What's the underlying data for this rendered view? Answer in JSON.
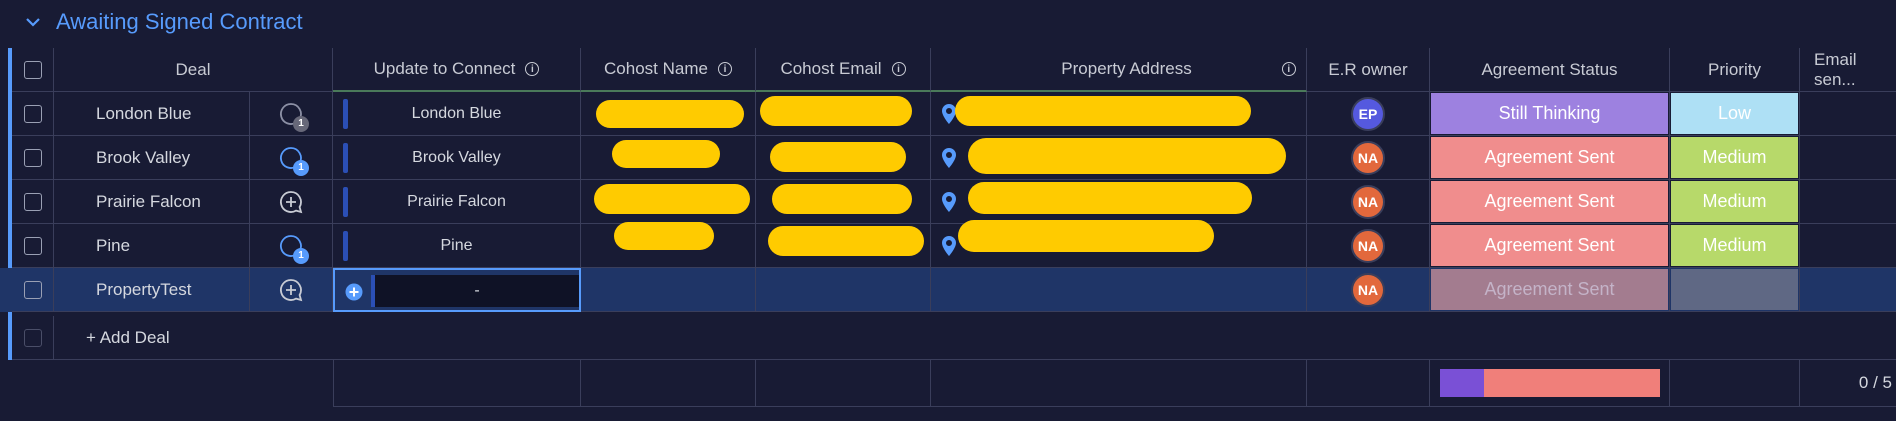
{
  "group": {
    "title": "Awaiting Signed Contract",
    "color": "#579bfc"
  },
  "columns": {
    "deal": "Deal",
    "update": "Update to Connect",
    "cohost_name": "Cohost Name",
    "cohost_email": "Cohost Email",
    "property_address": "Property Address",
    "er_owner": "E.R owner",
    "agreement_status": "Agreement Status",
    "priority": "Priority",
    "email_sent": "Email sen..."
  },
  "rows": [
    {
      "deal": "London Blue",
      "update": "London Blue",
      "conversation": "conversation-icon",
      "conv_count": "1",
      "conv_color": "#8c90a5",
      "owner": "EP",
      "owner_color": "#5559df",
      "status": "Still Thinking",
      "status_color": "#9d81e0",
      "priority": "Low",
      "priority_color": "#aee0f5",
      "priority_text_color": "#ffffff"
    },
    {
      "deal": "Brook Valley",
      "update": "Brook Valley",
      "conversation": "conversation-icon",
      "conv_count": "1",
      "conv_color": "#579bfc",
      "owner": "NA",
      "owner_color": "#e2683c",
      "status": "Agreement Sent",
      "status_color": "#f08d8d",
      "priority": "Medium",
      "priority_color": "#b7d96a",
      "priority_text_color": "#ffffff"
    },
    {
      "deal": "Prairie Falcon",
      "update": "Prairie Falcon",
      "conversation": "add-conversation-icon",
      "conv_count": "",
      "owner": "NA",
      "owner_color": "#e2683c",
      "status": "Agreement Sent",
      "status_color": "#f08d8d",
      "priority": "Medium",
      "priority_color": "#b7d96a",
      "priority_text_color": "#ffffff"
    },
    {
      "deal": "Pine",
      "update": "Pine",
      "conversation": "conversation-icon",
      "conv_count": "1",
      "conv_color": "#579bfc",
      "owner": "NA",
      "owner_color": "#e2683c",
      "status": "Agreement Sent",
      "status_color": "#f08d8d",
      "priority": "Medium",
      "priority_color": "#b7d96a",
      "priority_text_color": "#ffffff"
    },
    {
      "deal": "PropertyTest",
      "update": "-",
      "conversation": "add-conversation-icon",
      "conv_count": "",
      "owner": "NA",
      "owner_color": "#e2683c",
      "status": "Agreement Sent",
      "status_color": "#a37c8f",
      "priority": "",
      "priority_color": "#5f6884",
      "priority_text_color": "#ffffff"
    }
  ],
  "add_deal": "+ Add Deal",
  "summary": {
    "status_distribution": [
      {
        "color": "#7a50d6",
        "fraction": 0.2
      },
      {
        "color": "#f07f7a",
        "fraction": 0.8
      }
    ],
    "email_count": "0 / 5"
  }
}
